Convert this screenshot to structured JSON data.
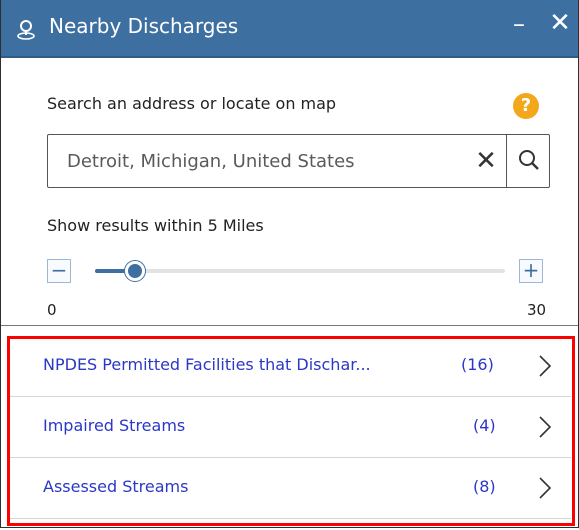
{
  "header": {
    "title": "Nearby Discharges",
    "minimize_label": "–",
    "close_label": "✕"
  },
  "search": {
    "label": "Search an address or locate on map",
    "value": "Detroit, Michigan, United States",
    "help_label": "?",
    "clear_label": "✕"
  },
  "range": {
    "label": "Show results within 5 Miles",
    "min_label": "0",
    "max_label": "30",
    "value": 5,
    "min": 0,
    "max": 30,
    "minus_label": "−",
    "plus_label": "+"
  },
  "results": [
    {
      "label": "NPDES Permitted Facilities that Dischar...",
      "count": "(16)"
    },
    {
      "label": "Impaired Streams",
      "count": "(4)"
    },
    {
      "label": "Assessed Streams",
      "count": "(8)"
    }
  ],
  "colors": {
    "accent": "#3e6fa1",
    "link": "#2b37c7",
    "help": "#f3a71b",
    "highlight": "#ff0000"
  },
  "icons": {
    "title": "location-pin-icon",
    "help": "help-icon",
    "search": "search-icon",
    "chevron": "chevron-right-icon"
  }
}
